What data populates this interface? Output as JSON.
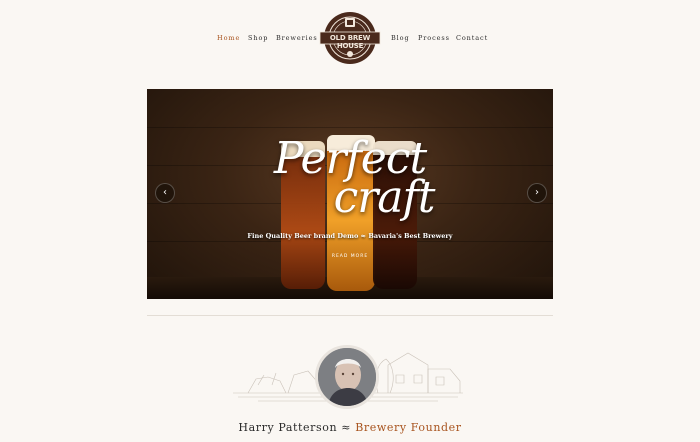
{
  "nav": {
    "items": [
      {
        "label": "Home",
        "active": true
      },
      {
        "label": "Shop",
        "active": false
      },
      {
        "label": "Breweries",
        "active": false
      },
      {
        "label": "Blog",
        "active": false
      },
      {
        "label": "Process",
        "active": false
      },
      {
        "label": "Contact",
        "active": false
      }
    ],
    "logo_text": "OLD BREW HOUSE",
    "active_color": "#a8541f"
  },
  "slider": {
    "title_line1": "Perfect",
    "title_line2": "craft",
    "tagline": "Fine Quality Beer brand Demo ≈ Bavaria's Best Brewery",
    "cta_label": "READ MORE",
    "prev_icon": "chevron-left-icon",
    "next_icon": "chevron-right-icon"
  },
  "founder": {
    "name": "Harry Patterson",
    "separator": "≈",
    "role": "Brewery Founder"
  }
}
